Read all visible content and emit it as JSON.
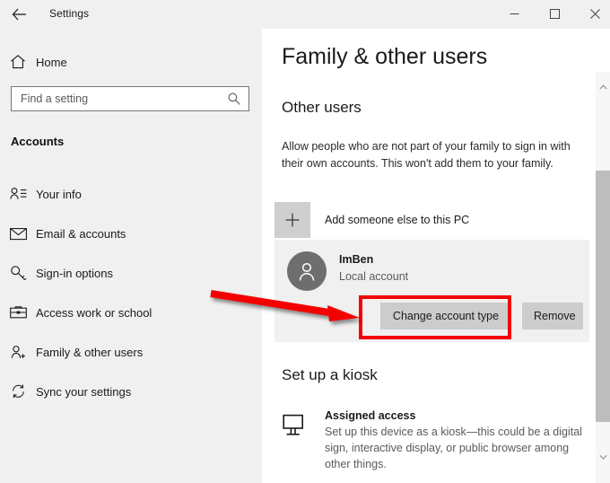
{
  "titlebar": {
    "back_icon": "back-arrow-icon",
    "title": "Settings",
    "minimize_icon": "minimize-icon",
    "maximize_icon": "maximize-icon",
    "close_icon": "close-icon"
  },
  "sidebar": {
    "home": {
      "label": "Home",
      "icon": "home-icon"
    },
    "search": {
      "placeholder": "Find a setting",
      "value": "",
      "icon": "search-icon"
    },
    "section_title": "Accounts",
    "items": [
      {
        "label": "Your info",
        "icon": "account-info-icon"
      },
      {
        "label": "Email & accounts",
        "icon": "envelope-icon"
      },
      {
        "label": "Sign-in options",
        "icon": "key-icon"
      },
      {
        "label": "Access work or school",
        "icon": "briefcase-icon"
      },
      {
        "label": "Family & other users",
        "icon": "person-add-icon"
      },
      {
        "label": "Sync your settings",
        "icon": "sync-icon"
      }
    ]
  },
  "content": {
    "page_title": "Family & other users",
    "other_users": {
      "heading": "Other users",
      "description": "Allow people who are not part of your family to sign in with their own accounts. This won't add them to your family.",
      "add_user": {
        "label": "Add someone else to this PC",
        "icon": "plus-icon"
      },
      "user": {
        "avatar_icon": "person-avatar-icon",
        "name": "ImBen",
        "account_type": "Local account",
        "change_account_type_label": "Change account type",
        "remove_label": "Remove"
      }
    },
    "kiosk": {
      "heading": "Set up a kiosk",
      "item_title": "Assigned access",
      "item_icon": "monitor-icon",
      "item_description": "Set up this device as a kiosk—this could be a digital sign, interactive display, or public browser among other things."
    }
  },
  "scrollbar": {
    "up_icon": "chevron-up-icon",
    "down_icon": "chevron-down-icon"
  },
  "annotations": {
    "highlight_color": "#f40000",
    "arrow_icon": "red-arrow-icon",
    "rect_icon": "red-highlight-rectangle"
  }
}
